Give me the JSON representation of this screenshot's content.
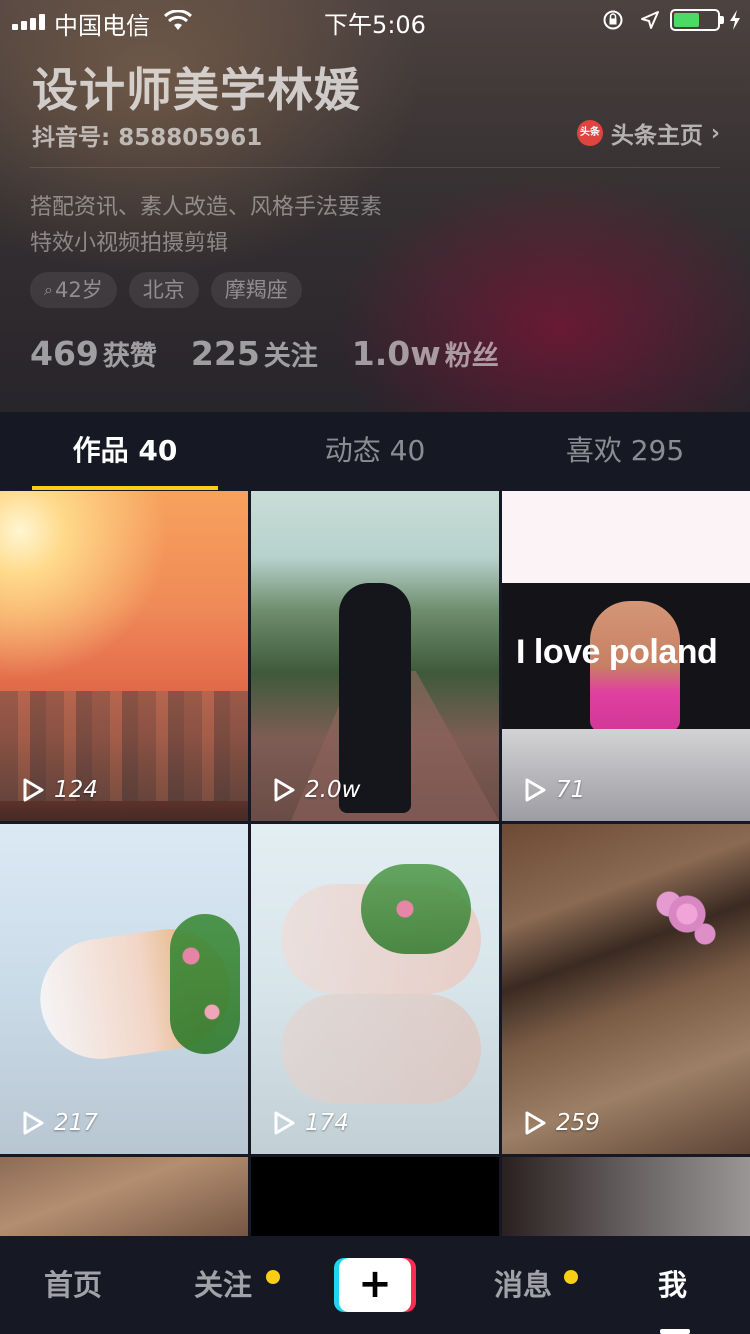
{
  "status_bar": {
    "carrier": "中国电信",
    "time": "下午5:06",
    "battery_level": 0.6
  },
  "profile": {
    "name": "设计师美学林媛",
    "douyin_id": "抖音号: 858805961",
    "toutiao_logo": "头条",
    "toutiao_link": "头条主页",
    "bio_line1": "搭配资讯、素人改造、风格手法要素",
    "bio_line2": "特效小视频拍摄剪辑",
    "tags": [
      "42岁",
      "北京",
      "摩羯座"
    ],
    "stats": [
      {
        "value": "469",
        "label": "获赞"
      },
      {
        "value": "225",
        "label": "关注"
      },
      {
        "value": "1.0w",
        "label": "粉丝"
      }
    ]
  },
  "tabs": [
    {
      "label": "作品 40",
      "active": true
    },
    {
      "label": "动态 40",
      "active": false
    },
    {
      "label": "喜欢 295",
      "active": false
    }
  ],
  "videos": [
    {
      "plays": "124"
    },
    {
      "plays": "2.0w",
      "caption": ""
    },
    {
      "plays": "71",
      "caption": "I love poland"
    },
    {
      "plays": "217"
    },
    {
      "plays": "174"
    },
    {
      "plays": "259"
    }
  ],
  "bottom_nav": [
    {
      "label": "首页",
      "dot": false
    },
    {
      "label": "关注",
      "dot": true
    },
    {
      "label": "+",
      "dot": false
    },
    {
      "label": "消息",
      "dot": true
    },
    {
      "label": "我",
      "dot": false,
      "active": true
    }
  ],
  "colors": {
    "accent": "#face15",
    "background": "#161823",
    "plus_left": "#20d5ec",
    "plus_right": "#fe2c55"
  }
}
